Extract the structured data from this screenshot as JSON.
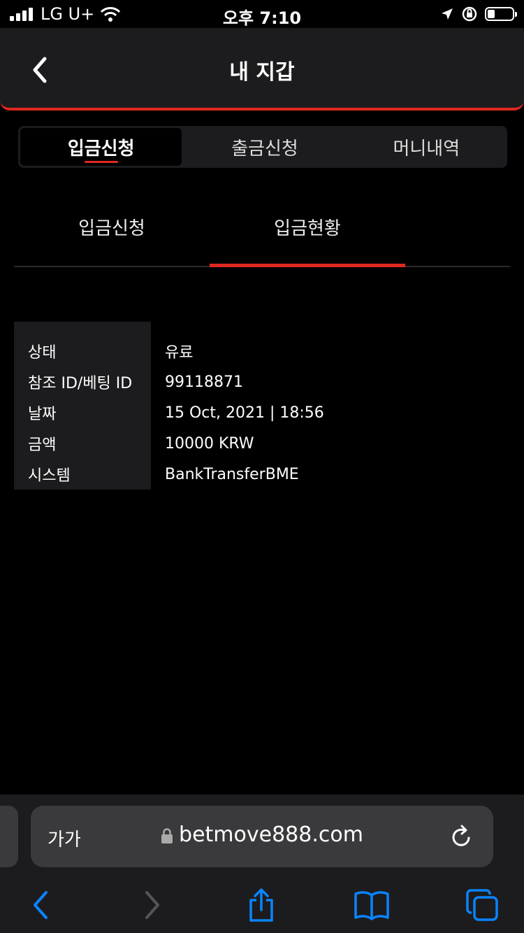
{
  "status_bar": {
    "carrier": "LG U+",
    "time": "오후 7:10"
  },
  "header": {
    "title": "내 지갑"
  },
  "tabs": [
    {
      "label": "입금신청",
      "active": true
    },
    {
      "label": "출금신청",
      "active": false
    },
    {
      "label": "머니내역",
      "active": false
    }
  ],
  "subtabs": [
    {
      "label": "입금신청",
      "active": false
    },
    {
      "label": "입금현황",
      "active": true
    }
  ],
  "details": [
    {
      "label": "상태",
      "value": "유료"
    },
    {
      "label": "참조 ID/베팅 ID",
      "value": "99118871"
    },
    {
      "label": "날짜",
      "value": "15 Oct, 2021 | 18:56"
    },
    {
      "label": "금액",
      "value": "10000 KRW"
    },
    {
      "label": "시스템",
      "value": "BankTransferBME"
    }
  ],
  "browser": {
    "text_size_label": "가가",
    "url": "betmove888.com"
  },
  "colors": {
    "accent": "#e0281f",
    "panel": "#1c1c1e",
    "ios_blue": "#0a84ff"
  },
  "icons": [
    "signal-icon",
    "wifi-icon",
    "location-icon",
    "orientation-lock-icon",
    "battery-icon",
    "back-chevron-icon",
    "lock-icon",
    "reload-icon",
    "nav-back-icon",
    "nav-forward-icon",
    "share-icon",
    "bookmarks-icon",
    "tabs-icon"
  ]
}
